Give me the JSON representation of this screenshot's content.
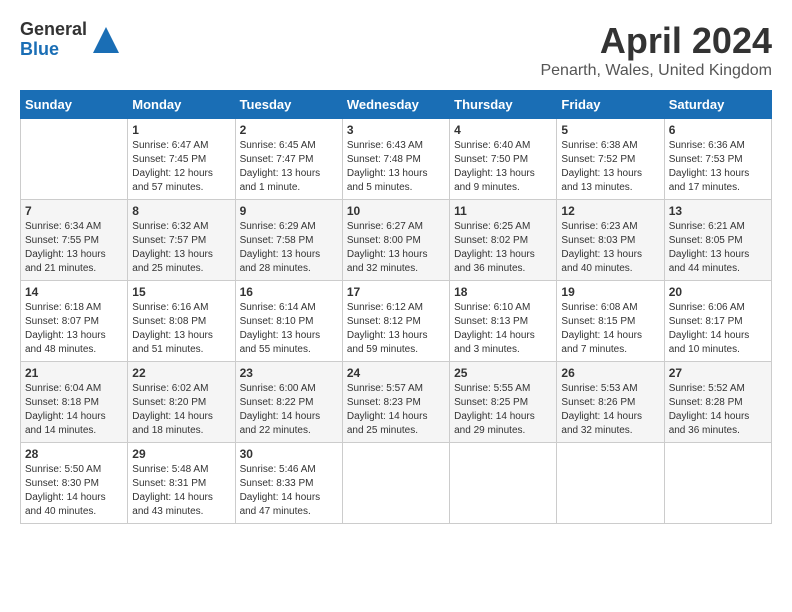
{
  "logo": {
    "general": "General",
    "blue": "Blue"
  },
  "title": "April 2024",
  "location": "Penarth, Wales, United Kingdom",
  "days_header": [
    "Sunday",
    "Monday",
    "Tuesday",
    "Wednesday",
    "Thursday",
    "Friday",
    "Saturday"
  ],
  "weeks": [
    [
      {
        "day": "",
        "sunrise": "",
        "sunset": "",
        "daylight": ""
      },
      {
        "day": "1",
        "sunrise": "Sunrise: 6:47 AM",
        "sunset": "Sunset: 7:45 PM",
        "daylight": "Daylight: 12 hours and 57 minutes."
      },
      {
        "day": "2",
        "sunrise": "Sunrise: 6:45 AM",
        "sunset": "Sunset: 7:47 PM",
        "daylight": "Daylight: 13 hours and 1 minute."
      },
      {
        "day": "3",
        "sunrise": "Sunrise: 6:43 AM",
        "sunset": "Sunset: 7:48 PM",
        "daylight": "Daylight: 13 hours and 5 minutes."
      },
      {
        "day": "4",
        "sunrise": "Sunrise: 6:40 AM",
        "sunset": "Sunset: 7:50 PM",
        "daylight": "Daylight: 13 hours and 9 minutes."
      },
      {
        "day": "5",
        "sunrise": "Sunrise: 6:38 AM",
        "sunset": "Sunset: 7:52 PM",
        "daylight": "Daylight: 13 hours and 13 minutes."
      },
      {
        "day": "6",
        "sunrise": "Sunrise: 6:36 AM",
        "sunset": "Sunset: 7:53 PM",
        "daylight": "Daylight: 13 hours and 17 minutes."
      }
    ],
    [
      {
        "day": "7",
        "sunrise": "Sunrise: 6:34 AM",
        "sunset": "Sunset: 7:55 PM",
        "daylight": "Daylight: 13 hours and 21 minutes."
      },
      {
        "day": "8",
        "sunrise": "Sunrise: 6:32 AM",
        "sunset": "Sunset: 7:57 PM",
        "daylight": "Daylight: 13 hours and 25 minutes."
      },
      {
        "day": "9",
        "sunrise": "Sunrise: 6:29 AM",
        "sunset": "Sunset: 7:58 PM",
        "daylight": "Daylight: 13 hours and 28 minutes."
      },
      {
        "day": "10",
        "sunrise": "Sunrise: 6:27 AM",
        "sunset": "Sunset: 8:00 PM",
        "daylight": "Daylight: 13 hours and 32 minutes."
      },
      {
        "day": "11",
        "sunrise": "Sunrise: 6:25 AM",
        "sunset": "Sunset: 8:02 PM",
        "daylight": "Daylight: 13 hours and 36 minutes."
      },
      {
        "day": "12",
        "sunrise": "Sunrise: 6:23 AM",
        "sunset": "Sunset: 8:03 PM",
        "daylight": "Daylight: 13 hours and 40 minutes."
      },
      {
        "day": "13",
        "sunrise": "Sunrise: 6:21 AM",
        "sunset": "Sunset: 8:05 PM",
        "daylight": "Daylight: 13 hours and 44 minutes."
      }
    ],
    [
      {
        "day": "14",
        "sunrise": "Sunrise: 6:18 AM",
        "sunset": "Sunset: 8:07 PM",
        "daylight": "Daylight: 13 hours and 48 minutes."
      },
      {
        "day": "15",
        "sunrise": "Sunrise: 6:16 AM",
        "sunset": "Sunset: 8:08 PM",
        "daylight": "Daylight: 13 hours and 51 minutes."
      },
      {
        "day": "16",
        "sunrise": "Sunrise: 6:14 AM",
        "sunset": "Sunset: 8:10 PM",
        "daylight": "Daylight: 13 hours and 55 minutes."
      },
      {
        "day": "17",
        "sunrise": "Sunrise: 6:12 AM",
        "sunset": "Sunset: 8:12 PM",
        "daylight": "Daylight: 13 hours and 59 minutes."
      },
      {
        "day": "18",
        "sunrise": "Sunrise: 6:10 AM",
        "sunset": "Sunset: 8:13 PM",
        "daylight": "Daylight: 14 hours and 3 minutes."
      },
      {
        "day": "19",
        "sunrise": "Sunrise: 6:08 AM",
        "sunset": "Sunset: 8:15 PM",
        "daylight": "Daylight: 14 hours and 7 minutes."
      },
      {
        "day": "20",
        "sunrise": "Sunrise: 6:06 AM",
        "sunset": "Sunset: 8:17 PM",
        "daylight": "Daylight: 14 hours and 10 minutes."
      }
    ],
    [
      {
        "day": "21",
        "sunrise": "Sunrise: 6:04 AM",
        "sunset": "Sunset: 8:18 PM",
        "daylight": "Daylight: 14 hours and 14 minutes."
      },
      {
        "day": "22",
        "sunrise": "Sunrise: 6:02 AM",
        "sunset": "Sunset: 8:20 PM",
        "daylight": "Daylight: 14 hours and 18 minutes."
      },
      {
        "day": "23",
        "sunrise": "Sunrise: 6:00 AM",
        "sunset": "Sunset: 8:22 PM",
        "daylight": "Daylight: 14 hours and 22 minutes."
      },
      {
        "day": "24",
        "sunrise": "Sunrise: 5:57 AM",
        "sunset": "Sunset: 8:23 PM",
        "daylight": "Daylight: 14 hours and 25 minutes."
      },
      {
        "day": "25",
        "sunrise": "Sunrise: 5:55 AM",
        "sunset": "Sunset: 8:25 PM",
        "daylight": "Daylight: 14 hours and 29 minutes."
      },
      {
        "day": "26",
        "sunrise": "Sunrise: 5:53 AM",
        "sunset": "Sunset: 8:26 PM",
        "daylight": "Daylight: 14 hours and 32 minutes."
      },
      {
        "day": "27",
        "sunrise": "Sunrise: 5:52 AM",
        "sunset": "Sunset: 8:28 PM",
        "daylight": "Daylight: 14 hours and 36 minutes."
      }
    ],
    [
      {
        "day": "28",
        "sunrise": "Sunrise: 5:50 AM",
        "sunset": "Sunset: 8:30 PM",
        "daylight": "Daylight: 14 hours and 40 minutes."
      },
      {
        "day": "29",
        "sunrise": "Sunrise: 5:48 AM",
        "sunset": "Sunset: 8:31 PM",
        "daylight": "Daylight: 14 hours and 43 minutes."
      },
      {
        "day": "30",
        "sunrise": "Sunrise: 5:46 AM",
        "sunset": "Sunset: 8:33 PM",
        "daylight": "Daylight: 14 hours and 47 minutes."
      },
      {
        "day": "",
        "sunrise": "",
        "sunset": "",
        "daylight": ""
      },
      {
        "day": "",
        "sunrise": "",
        "sunset": "",
        "daylight": ""
      },
      {
        "day": "",
        "sunrise": "",
        "sunset": "",
        "daylight": ""
      },
      {
        "day": "",
        "sunrise": "",
        "sunset": "",
        "daylight": ""
      }
    ]
  ]
}
